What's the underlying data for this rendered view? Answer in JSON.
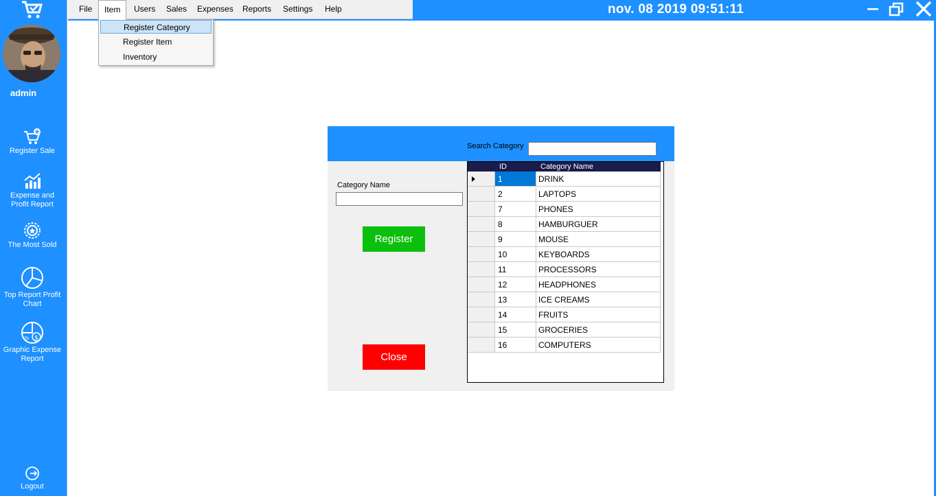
{
  "sidebar": {
    "username": "admin",
    "items": [
      {
        "label": "Register Sale",
        "icon": "cart-plus-icon"
      },
      {
        "label": "Expense and\nProfit Report",
        "icon": "bar-chart-icon"
      },
      {
        "label": "The Most Sold",
        "icon": "badge-icon"
      },
      {
        "label": "Top Report Profit\nChart",
        "icon": "pie-chart-icon"
      },
      {
        "label": "Graphic Expense\nReport",
        "icon": "dollar-pie-icon"
      }
    ],
    "logout": {
      "label": "Logout",
      "icon": "logout-icon"
    }
  },
  "menubar": {
    "menus": [
      "File",
      "Item",
      "Users",
      "Sales",
      "Expenses",
      "Reports",
      "Settings",
      "Help"
    ],
    "open_menu": "Item",
    "dropdown": [
      "Register Category",
      "Register Item",
      "Inventory"
    ],
    "highlighted": "Register Category"
  },
  "titlebar": {
    "datetime": "nov. 08 2019  09:51:11"
  },
  "form": {
    "search_label": "Search Category",
    "search_value": "",
    "category_label": "Category Name",
    "category_value": "",
    "register_label": "Register",
    "close_label": "Close"
  },
  "grid": {
    "columns": [
      "ID",
      "Category Name"
    ],
    "rows": [
      {
        "id": "1",
        "name": "DRINK"
      },
      {
        "id": "2",
        "name": "LAPTOPS"
      },
      {
        "id": "7",
        "name": "PHONES"
      },
      {
        "id": "8",
        "name": "HAMBURGUER"
      },
      {
        "id": "9",
        "name": "MOUSE"
      },
      {
        "id": "10",
        "name": "KEYBOARDS"
      },
      {
        "id": "11",
        "name": "PROCESSORS"
      },
      {
        "id": "12",
        "name": "HEADPHONES"
      },
      {
        "id": "13",
        "name": "ICE CREAMS"
      },
      {
        "id": "14",
        "name": "FRUITS"
      },
      {
        "id": "15",
        "name": "GROCERIES"
      },
      {
        "id": "16",
        "name": "COMPUTERS"
      }
    ],
    "selected_row": 0
  },
  "colors": {
    "accent": "#1e90ff",
    "register_button": "#0cbf0c",
    "close_button": "#ff0000",
    "grid_header": "#1a1c4b",
    "selection": "#0078d7"
  }
}
